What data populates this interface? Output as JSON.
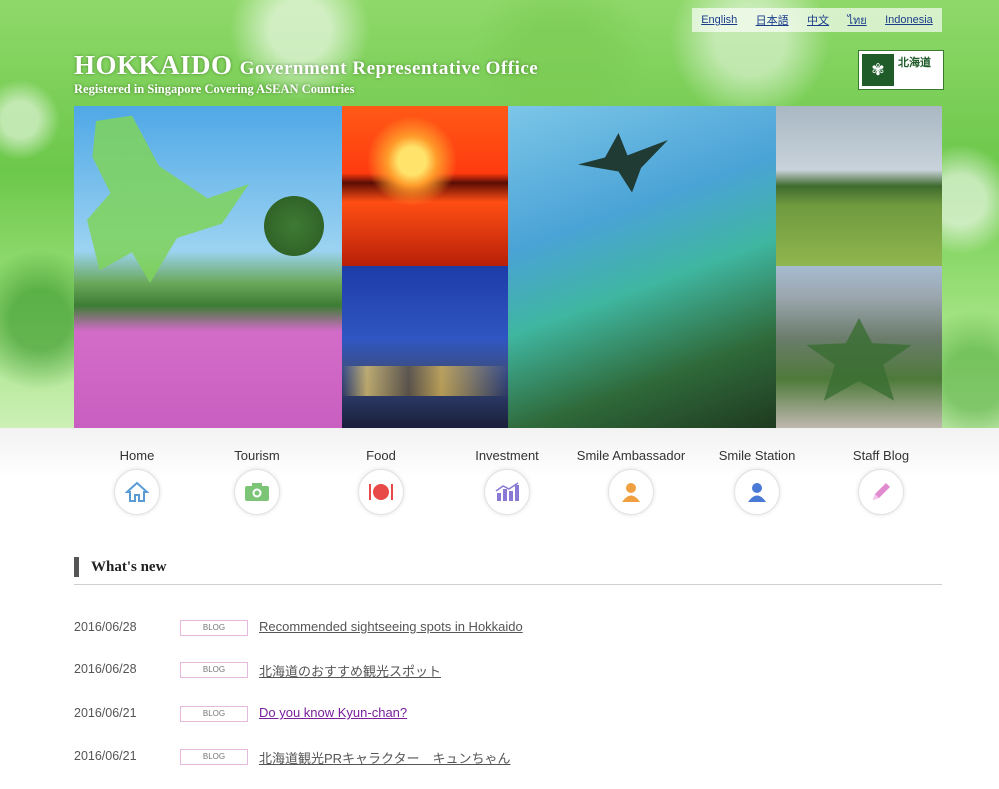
{
  "languages": [
    "English",
    "日本語",
    "中文",
    "ไทย",
    "Indonesia"
  ],
  "header": {
    "title_lead": "HOKKAIDO",
    "title_rest": "Government Representative Office",
    "subtitle": "Registered in Singapore Covering ASEAN Countries",
    "logo_text": "北海道"
  },
  "nav": [
    {
      "label": "Home",
      "icon": "house-icon",
      "color": "#5b9bd5"
    },
    {
      "label": "Tourism",
      "icon": "camera-icon",
      "color": "#7cc576"
    },
    {
      "label": "Food",
      "icon": "dining-icon",
      "color": "#e84a4a"
    },
    {
      "label": "Investment",
      "icon": "chart-icon",
      "color": "#8a7ad6"
    },
    {
      "label": "Smile Ambassador",
      "icon": "person-icon",
      "color": "#f0a040"
    },
    {
      "label": "Smile Station",
      "icon": "person-icon",
      "color": "#4a7ad6"
    },
    {
      "label": "Staff Blog",
      "icon": "pencil-icon",
      "color": "#e08ad0"
    }
  ],
  "news": {
    "heading": "What's new",
    "items": [
      {
        "date": "2016/06/28",
        "badge": "BLOG",
        "title": "Recommended sightseeing spots in Hokkaido"
      },
      {
        "date": "2016/06/28",
        "badge": "BLOG",
        "title": "北海道のおすすめ観光スポット"
      },
      {
        "date": "2016/06/21",
        "badge": "BLOG",
        "title": "Do you know Kyun-chan?"
      },
      {
        "date": "2016/06/21",
        "badge": "BLOG",
        "title": "北海道観光PRキャラクター　キュンちゃん"
      }
    ]
  },
  "colors": {
    "accent_green": "#6cc84a",
    "visited_link": "#7a1f9c",
    "heading_bar": "#555555"
  }
}
